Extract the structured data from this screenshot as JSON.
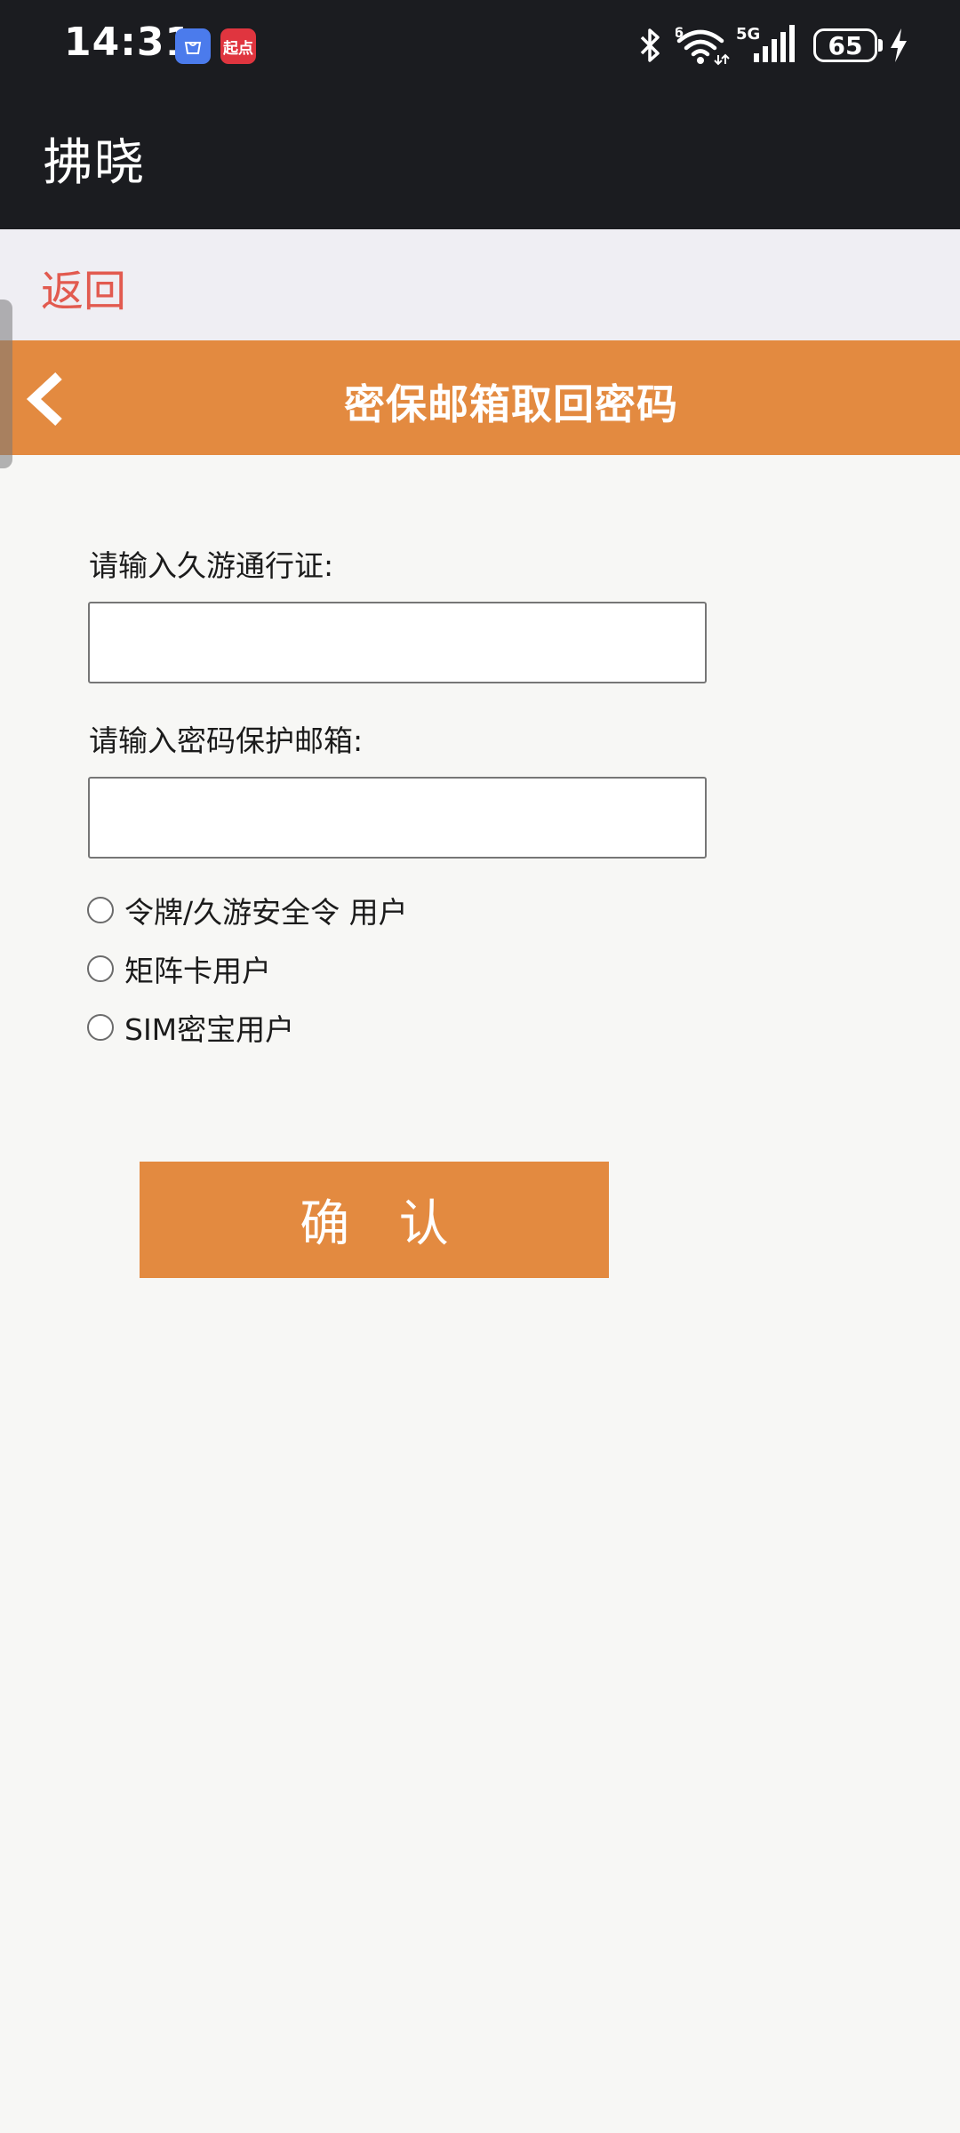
{
  "status_bar": {
    "time": "14:31",
    "notification_icons": [
      "app-store-icon",
      "qidian-icon"
    ],
    "qidian_label": "起点",
    "network": "5G",
    "wifi_badge": "6",
    "battery_level": "65",
    "icons": [
      "bluetooth-icon",
      "wifi-icon",
      "signal-icon",
      "battery-icon",
      "charging-icon"
    ]
  },
  "app_bar": {
    "title": "拂晓"
  },
  "nav": {
    "return_label": "返回"
  },
  "page_header": {
    "title": "密保邮箱取回密码",
    "back_icon": "chevron-left-icon"
  },
  "form": {
    "account_label": "请输入久游通行证:",
    "account_value": "",
    "email_label": "请输入密码保护邮箱:",
    "email_value": "",
    "options": [
      {
        "label": "令牌/久游安全令 用户",
        "checked": false
      },
      {
        "label": "矩阵卡用户",
        "checked": false
      },
      {
        "label": "SIM密宝用户",
        "checked": false
      }
    ],
    "submit_label": "确 认"
  },
  "colors": {
    "accent": "#e38a40",
    "return_link": "#e25a4f",
    "dark_bar": "#1b1c20",
    "background": "#f7f7f5"
  }
}
